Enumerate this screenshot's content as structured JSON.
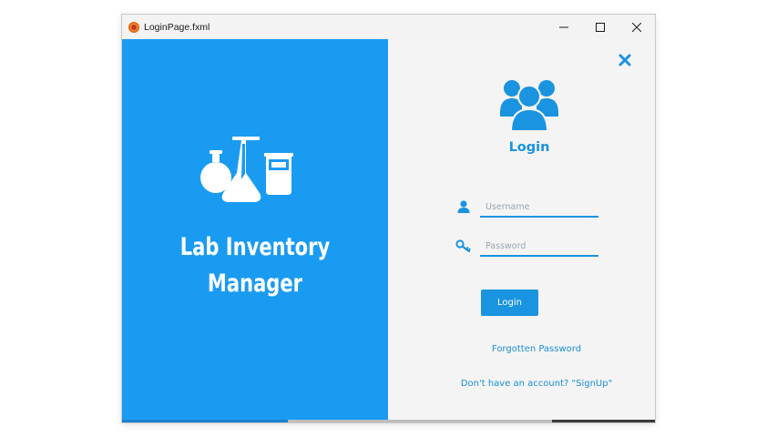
{
  "window": {
    "title": "LoginPage.fxml"
  },
  "icons": {
    "app": "app-logo-icon",
    "minimize": "minimize-icon",
    "maximize": "maximize-icon",
    "close_window": "close-window-icon",
    "lab": "lab-flasks-icon",
    "close_panel": "close-icon",
    "users": "users-group-icon",
    "user": "user-icon",
    "key": "key-icon"
  },
  "brand": {
    "line1": "Lab Inventory",
    "line2": "Manager"
  },
  "login": {
    "heading": "Login",
    "username_placeholder": "Username",
    "username_value": "",
    "password_placeholder": "Password",
    "password_value": "",
    "button_label": "Login",
    "forgot_link": "Forgotten Password",
    "signup_link": "Don't have an account? \"SignUp\""
  },
  "colors": {
    "accent": "#1a9bf2",
    "accent_text": "#1a93e0",
    "panel_bg": "#f4f4f4"
  }
}
